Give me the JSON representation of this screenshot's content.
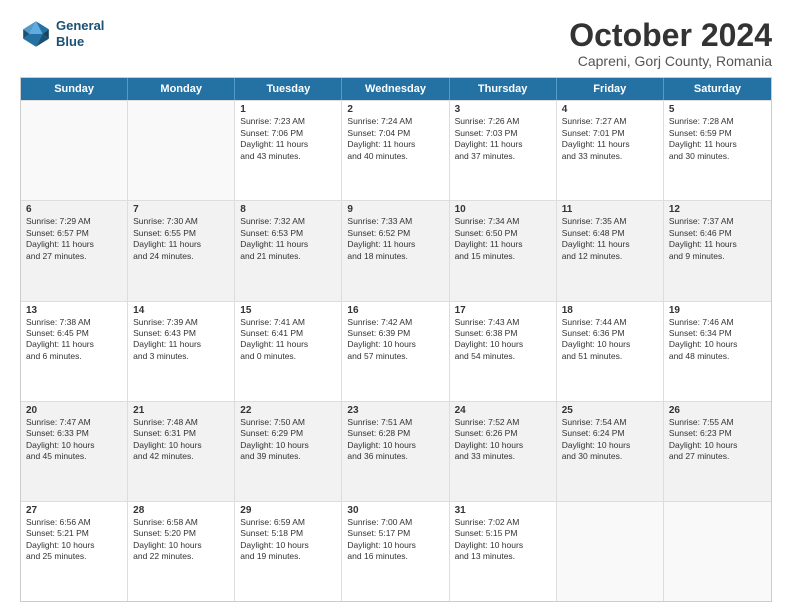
{
  "header": {
    "logo_line1": "General",
    "logo_line2": "Blue",
    "month": "October 2024",
    "location": "Capreni, Gorj County, Romania"
  },
  "days": [
    "Sunday",
    "Monday",
    "Tuesday",
    "Wednesday",
    "Thursday",
    "Friday",
    "Saturday"
  ],
  "rows": [
    [
      {
        "day": "",
        "empty": true
      },
      {
        "day": "",
        "empty": true
      },
      {
        "day": "1",
        "lines": [
          "Sunrise: 7:23 AM",
          "Sunset: 7:06 PM",
          "Daylight: 11 hours",
          "and 43 minutes."
        ]
      },
      {
        "day": "2",
        "lines": [
          "Sunrise: 7:24 AM",
          "Sunset: 7:04 PM",
          "Daylight: 11 hours",
          "and 40 minutes."
        ]
      },
      {
        "day": "3",
        "lines": [
          "Sunrise: 7:26 AM",
          "Sunset: 7:03 PM",
          "Daylight: 11 hours",
          "and 37 minutes."
        ]
      },
      {
        "day": "4",
        "lines": [
          "Sunrise: 7:27 AM",
          "Sunset: 7:01 PM",
          "Daylight: 11 hours",
          "and 33 minutes."
        ]
      },
      {
        "day": "5",
        "lines": [
          "Sunrise: 7:28 AM",
          "Sunset: 6:59 PM",
          "Daylight: 11 hours",
          "and 30 minutes."
        ]
      }
    ],
    [
      {
        "day": "6",
        "lines": [
          "Sunrise: 7:29 AM",
          "Sunset: 6:57 PM",
          "Daylight: 11 hours",
          "and 27 minutes."
        ]
      },
      {
        "day": "7",
        "lines": [
          "Sunrise: 7:30 AM",
          "Sunset: 6:55 PM",
          "Daylight: 11 hours",
          "and 24 minutes."
        ]
      },
      {
        "day": "8",
        "lines": [
          "Sunrise: 7:32 AM",
          "Sunset: 6:53 PM",
          "Daylight: 11 hours",
          "and 21 minutes."
        ]
      },
      {
        "day": "9",
        "lines": [
          "Sunrise: 7:33 AM",
          "Sunset: 6:52 PM",
          "Daylight: 11 hours",
          "and 18 minutes."
        ]
      },
      {
        "day": "10",
        "lines": [
          "Sunrise: 7:34 AM",
          "Sunset: 6:50 PM",
          "Daylight: 11 hours",
          "and 15 minutes."
        ]
      },
      {
        "day": "11",
        "lines": [
          "Sunrise: 7:35 AM",
          "Sunset: 6:48 PM",
          "Daylight: 11 hours",
          "and 12 minutes."
        ]
      },
      {
        "day": "12",
        "lines": [
          "Sunrise: 7:37 AM",
          "Sunset: 6:46 PM",
          "Daylight: 11 hours",
          "and 9 minutes."
        ]
      }
    ],
    [
      {
        "day": "13",
        "lines": [
          "Sunrise: 7:38 AM",
          "Sunset: 6:45 PM",
          "Daylight: 11 hours",
          "and 6 minutes."
        ]
      },
      {
        "day": "14",
        "lines": [
          "Sunrise: 7:39 AM",
          "Sunset: 6:43 PM",
          "Daylight: 11 hours",
          "and 3 minutes."
        ]
      },
      {
        "day": "15",
        "lines": [
          "Sunrise: 7:41 AM",
          "Sunset: 6:41 PM",
          "Daylight: 11 hours",
          "and 0 minutes."
        ]
      },
      {
        "day": "16",
        "lines": [
          "Sunrise: 7:42 AM",
          "Sunset: 6:39 PM",
          "Daylight: 10 hours",
          "and 57 minutes."
        ]
      },
      {
        "day": "17",
        "lines": [
          "Sunrise: 7:43 AM",
          "Sunset: 6:38 PM",
          "Daylight: 10 hours",
          "and 54 minutes."
        ]
      },
      {
        "day": "18",
        "lines": [
          "Sunrise: 7:44 AM",
          "Sunset: 6:36 PM",
          "Daylight: 10 hours",
          "and 51 minutes."
        ]
      },
      {
        "day": "19",
        "lines": [
          "Sunrise: 7:46 AM",
          "Sunset: 6:34 PM",
          "Daylight: 10 hours",
          "and 48 minutes."
        ]
      }
    ],
    [
      {
        "day": "20",
        "lines": [
          "Sunrise: 7:47 AM",
          "Sunset: 6:33 PM",
          "Daylight: 10 hours",
          "and 45 minutes."
        ]
      },
      {
        "day": "21",
        "lines": [
          "Sunrise: 7:48 AM",
          "Sunset: 6:31 PM",
          "Daylight: 10 hours",
          "and 42 minutes."
        ]
      },
      {
        "day": "22",
        "lines": [
          "Sunrise: 7:50 AM",
          "Sunset: 6:29 PM",
          "Daylight: 10 hours",
          "and 39 minutes."
        ]
      },
      {
        "day": "23",
        "lines": [
          "Sunrise: 7:51 AM",
          "Sunset: 6:28 PM",
          "Daylight: 10 hours",
          "and 36 minutes."
        ]
      },
      {
        "day": "24",
        "lines": [
          "Sunrise: 7:52 AM",
          "Sunset: 6:26 PM",
          "Daylight: 10 hours",
          "and 33 minutes."
        ]
      },
      {
        "day": "25",
        "lines": [
          "Sunrise: 7:54 AM",
          "Sunset: 6:24 PM",
          "Daylight: 10 hours",
          "and 30 minutes."
        ]
      },
      {
        "day": "26",
        "lines": [
          "Sunrise: 7:55 AM",
          "Sunset: 6:23 PM",
          "Daylight: 10 hours",
          "and 27 minutes."
        ]
      }
    ],
    [
      {
        "day": "27",
        "lines": [
          "Sunrise: 6:56 AM",
          "Sunset: 5:21 PM",
          "Daylight: 10 hours",
          "and 25 minutes."
        ]
      },
      {
        "day": "28",
        "lines": [
          "Sunrise: 6:58 AM",
          "Sunset: 5:20 PM",
          "Daylight: 10 hours",
          "and 22 minutes."
        ]
      },
      {
        "day": "29",
        "lines": [
          "Sunrise: 6:59 AM",
          "Sunset: 5:18 PM",
          "Daylight: 10 hours",
          "and 19 minutes."
        ]
      },
      {
        "day": "30",
        "lines": [
          "Sunrise: 7:00 AM",
          "Sunset: 5:17 PM",
          "Daylight: 10 hours",
          "and 16 minutes."
        ]
      },
      {
        "day": "31",
        "lines": [
          "Sunrise: 7:02 AM",
          "Sunset: 5:15 PM",
          "Daylight: 10 hours",
          "and 13 minutes."
        ]
      },
      {
        "day": "",
        "empty": true
      },
      {
        "day": "",
        "empty": true
      }
    ]
  ]
}
